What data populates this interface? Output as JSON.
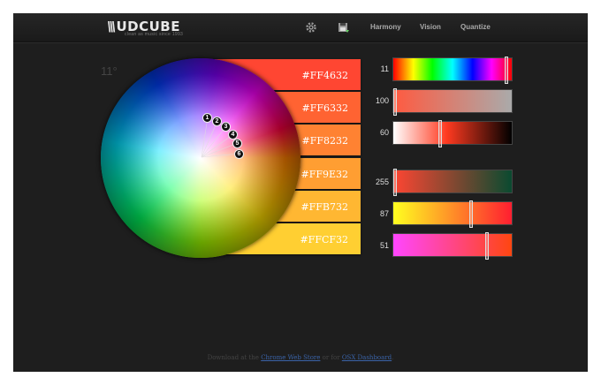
{
  "header": {
    "logo": "UDCUBE",
    "tagline": "clean as music since 1993",
    "nav": {
      "harmony": "Harmony",
      "vision": "Vision",
      "quantize": "Quantize"
    },
    "icons": [
      "gear-icon",
      "save-icon"
    ]
  },
  "wheel": {
    "angle": "11°",
    "markers": [
      "1",
      "2",
      "3",
      "4",
      "5",
      "6"
    ]
  },
  "swatches": [
    {
      "hex": "#FF4632",
      "color": "#FF4632"
    },
    {
      "hex": "#FF6332",
      "color": "#FF6332"
    },
    {
      "hex": "#FF8232",
      "color": "#FF8232"
    },
    {
      "hex": "#FF9E32",
      "color": "#FF9E32"
    },
    {
      "hex": "#FFB732",
      "color": "#FFB732"
    },
    {
      "hex": "#FFCF32",
      "color": "#FFCF32"
    }
  ],
  "sliders": [
    {
      "value": "11",
      "fraction": 0.97
    },
    {
      "value": "100",
      "fraction": 0.0
    },
    {
      "value": "60",
      "fraction": 0.39
    },
    {
      "value": "255",
      "fraction": 0.0
    },
    {
      "value": "87",
      "fraction": 0.66
    },
    {
      "value": "51",
      "fraction": 0.8
    }
  ],
  "footer": {
    "prefix": "Download at the",
    "link1": "Chrome Web Store",
    "middle": "or for",
    "link2": "OSX Dashboard",
    "suffix": "."
  }
}
